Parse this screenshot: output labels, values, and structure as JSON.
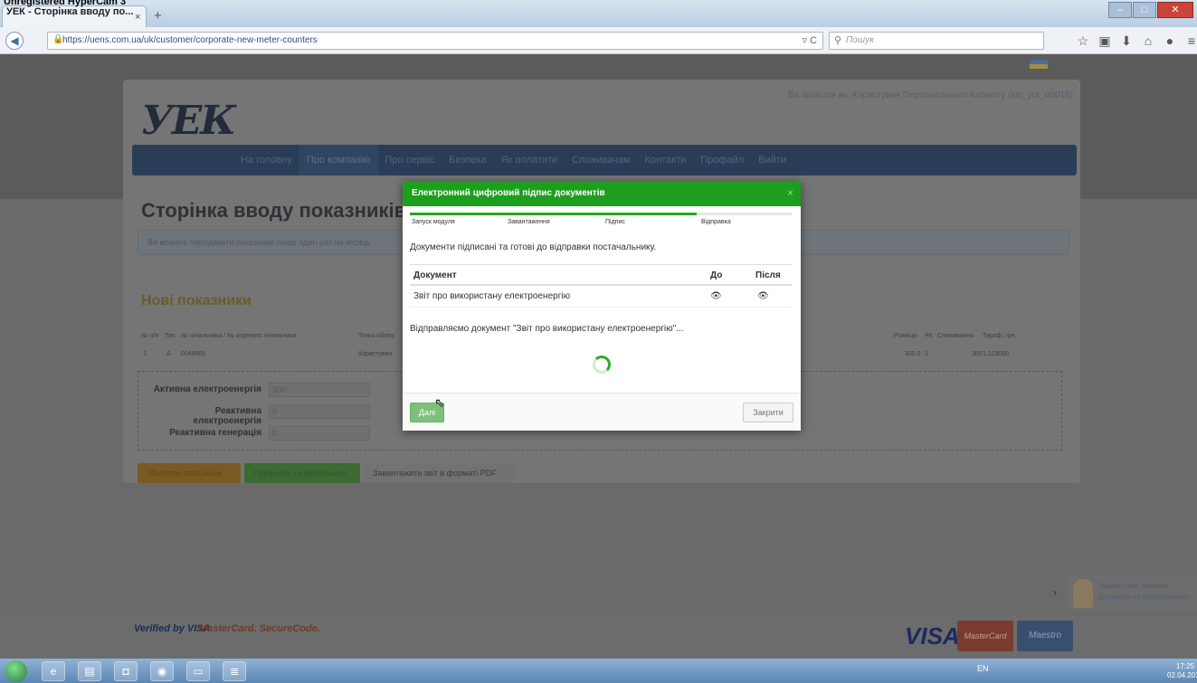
{
  "browser": {
    "tab_title": "УЕК - Сторінка вводу по...",
    "tab_close": "×",
    "new_tab": "+",
    "url": "https://uens.com.ua/uk/customer/corporate-new-meter-counters",
    "search_placeholder": "Пошук",
    "watermark": "Unregistered HyperCam 3"
  },
  "site": {
    "logo": "УЕК",
    "logged_in": "Ви авійшли як: Користувач Персонального Кабінету (kic_yur_00016)",
    "menu": [
      "На головну",
      "Про компанію",
      "Про сервіс",
      "Безпека",
      "Як оплатити",
      "Споживачам",
      "Контакти",
      "Профайл",
      "Вийти"
    ],
    "page_title": "Сторінка вводу показників",
    "info_text": "Ви можете передавати показники лише один раз на місяць",
    "section_title": "Нові показники",
    "table_headers": [
      "№ п/п",
      "Тип",
      "№ лічильника / № кореного лічильника",
      "Точка обліку",
      "Різниця",
      "РК",
      "Споживання",
      "Тариф, грн."
    ],
    "table_row": [
      "1",
      "А",
      "0049005",
      "Користувач",
      "300.0",
      "1",
      "300",
      "1.123000"
    ],
    "fields": [
      {
        "label": "Активна електроенергія",
        "value": "300"
      },
      {
        "label": "Реактивна електроенергія",
        "value": "0"
      },
      {
        "label": "Реактивна генерація",
        "value": "0"
      }
    ],
    "buttons": {
      "save": "Зберегти показники",
      "sign_send": "Підписати та відправити",
      "download_pdf": "Завантажити звіт в форматі PDF"
    },
    "footer": {
      "verified": "Verified by VISA",
      "mc_secure": "MasterCard. SecureCode.",
      "visa": "VISA",
      "mastercard": "MasterCard",
      "maestro": "Maestro"
    },
    "help": {
      "line1": "Задати своє питання",
      "line2": "Допомога на Віртуальному"
    }
  },
  "modal": {
    "title": "Електронний цифровий підпис документів",
    "close": "×",
    "progress": 0.75,
    "steps": [
      "Запуск модуля",
      "Завантаження",
      "Підпис",
      "Відправка"
    ],
    "message_signed": "Документи підписані та готові до відправки постачальнику.",
    "col_document": "Документ",
    "col_before": "До",
    "col_after": "Після",
    "doc_name": "Звіт про використану електроенергію",
    "sending_message": "Відправляємо документ \"Звіт про використану електроенергію\"...",
    "next_label": "Далі",
    "close_label": "Закрити"
  },
  "taskbar": {
    "lang": "EN",
    "time": "17:25",
    "date": "02.04.2015"
  }
}
